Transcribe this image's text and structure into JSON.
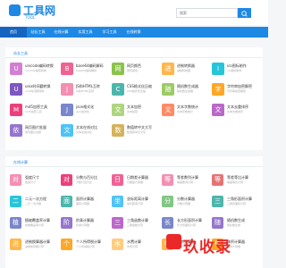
{
  "brand": {
    "title": "工具网",
    "subtitle": "TOOL"
  },
  "search": {
    "placeholder": "搜索",
    "button_icon": "search-icon"
  },
  "nav": {
    "items": [
      {
        "label": "首页",
        "active": true
      },
      {
        "label": "站长工具",
        "active": false
      },
      {
        "label": "在线计算",
        "active": false
      },
      {
        "label": "实用工具",
        "active": false
      },
      {
        "label": "学习工具",
        "active": false
      },
      {
        "label": "在线转换",
        "active": false
      }
    ]
  },
  "webmaster": {
    "title": "站长工具",
    "tools": [
      {
        "icon": "U",
        "color": "#d37fd3",
        "name": "unicode编码转换",
        "desc": "unicode编码转换"
      },
      {
        "icon": "B",
        "color": "#f06292",
        "name": "base64编码解码",
        "desc": "base64编码解码"
      },
      {
        "icon": "网",
        "color": "#8bc34a",
        "name": "网页颜色",
        "desc": "网页颜色"
      },
      {
        "icon": "进",
        "color": "#ffb74d",
        "name": "进制转换器",
        "desc": "进制转换器"
      },
      {
        "icon": "I",
        "color": "#26c6da",
        "name": "ico图标制作",
        "desc": "ico图标制作"
      },
      {
        "icon": "U",
        "color": "#7e57c2",
        "name": "unix时间戳转换",
        "desc": "unix时间戳转换"
      },
      {
        "icon": "J",
        "color": "#f48fb1",
        "name": "JS和HTML互转",
        "desc": "JS和HTML互转"
      },
      {
        "icon": "C",
        "color": "#4db6ac",
        "name": "CSS格式化压缩",
        "desc": "CSS格式化压缩"
      },
      {
        "icon": "随",
        "color": "#9ccc65",
        "name": "随机数生成器",
        "desc": "随机数生成器"
      },
      {
        "icon": "字",
        "color": "#ffa726",
        "name": "字符串加密解密",
        "desc": "字符串加密解密"
      },
      {
        "icon": "M",
        "color": "#ec407a",
        "name": "md5加密工具",
        "desc": "md5加密工具"
      },
      {
        "icon": "J",
        "color": "#7986cb",
        "name": "json格式化",
        "desc": "json格式化"
      },
      {
        "icon": "文",
        "color": "#aed581",
        "name": "文本加密",
        "desc": "文本加密"
      },
      {
        "icon": "文",
        "color": "#ff8a65",
        "name": "文本字数统计",
        "desc": "文本字数统计"
      },
      {
        "icon": "文",
        "color": "#ba68c8",
        "name": "文本去重排序",
        "desc": "文本去重排序"
      },
      {
        "icon": "依",
        "color": "#9575cd",
        "name": "网页图片批量",
        "desc": "网页图片批量"
      },
      {
        "icon": "文",
        "color": "#4fc3f7",
        "name": "文本在线对比",
        "desc": "文本在线对比"
      },
      {
        "icon": "数",
        "color": "#d4b35e",
        "name": "数值转中文大写",
        "desc": "数值转中文大写"
      }
    ]
  },
  "calculators": {
    "title": "在线计算",
    "tools": [
      {
        "icon": "对",
        "color": "#f48fb1",
        "name": "弧度尺寸",
        "desc": "弧度尺寸"
      },
      {
        "icon": "对",
        "color": "#ec407a",
        "name": "分数与百分比",
        "desc": "分数与百分比"
      },
      {
        "icon": "日",
        "color": "#f06292",
        "name": "日期差计算器",
        "desc": "日期差计算器"
      },
      {
        "icon": "等",
        "color": "#f48fb1",
        "name": "等差数列计算",
        "desc": "等差数列计算"
      },
      {
        "icon": "等",
        "color": "#e57373",
        "name": "等差等比计算",
        "desc": "等差等比计算"
      },
      {
        "icon": "二",
        "color": "#26c6da",
        "name": "二元一次方程",
        "desc": "二元一次方程"
      },
      {
        "icon": "面",
        "color": "#4db6ac",
        "name": "面积计算器",
        "desc": "面积计算器"
      },
      {
        "icon": "坐",
        "color": "#4fc3f7",
        "name": "坐标距离计算",
        "desc": "坐标距离计算"
      },
      {
        "icon": "分",
        "color": "#81c784",
        "name": "分数计算器",
        "desc": "分数计算器"
      },
      {
        "icon": "三",
        "color": "#4db6ac",
        "name": "三角形面积计算",
        "desc": "三角形面积计算"
      },
      {
        "icon": "植",
        "color": "#7986cb",
        "name": "植被覆盖率计算",
        "desc": "植被覆盖率计算"
      },
      {
        "icon": "阶",
        "color": "#9575cd",
        "name": "阶乘计算器",
        "desc": "阶乘计算器"
      },
      {
        "icon": "三",
        "color": "#ba68c8",
        "name": "三角函数计算",
        "desc": "三角函数计算"
      },
      {
        "icon": "长",
        "color": "#7986cb",
        "name": "长方形面积计算",
        "desc": "长方形面积计算"
      },
      {
        "icon": "随",
        "color": "#9575cd",
        "name": "随机数生成",
        "desc": "随机数生成"
      },
      {
        "icon": "进",
        "color": "#ffb74d",
        "name": "进制换算器计算",
        "desc": "进制换算器计算"
      },
      {
        "icon": "个",
        "color": "#ffa726",
        "name": "个人所得税计算",
        "desc": "个人所得税计算"
      },
      {
        "icon": "水",
        "color": "#ffcc80",
        "name": "水费计算",
        "desc": "水费计算"
      },
      {
        "icon": "年",
        "color": "#ffb74d",
        "name": "年龄计算器",
        "desc": "年龄计算器"
      },
      {
        "icon": "体",
        "color": "#ffa726",
        "name": "体积计算器",
        "desc": "体积计算器"
      }
    ]
  },
  "watermark": {
    "text": "玖收录"
  }
}
